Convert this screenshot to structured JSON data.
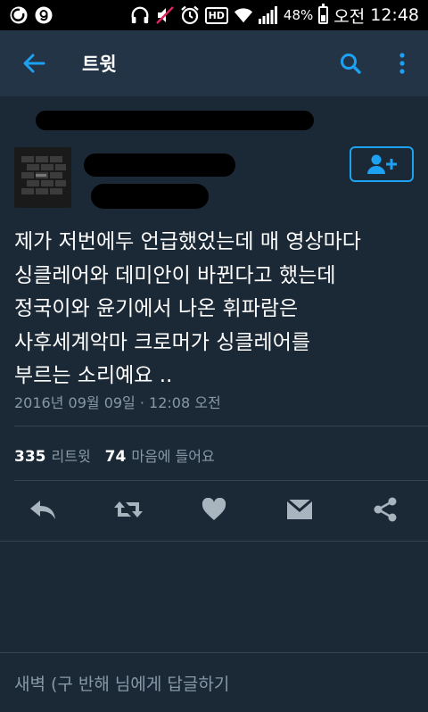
{
  "status_bar": {
    "battery": "48%",
    "battery_level": 0.48,
    "ampm": "오전",
    "time": "12:48",
    "hd_label": "HD",
    "icons": [
      "circle-app-icon",
      "g-app-icon",
      "headset-icon",
      "mute-icon",
      "alarm-icon",
      "hd-icon",
      "wifi-icon",
      "signal-icon",
      "battery-icon"
    ]
  },
  "app_bar": {
    "title": "트윗",
    "back_icon": "back-arrow-icon",
    "search_icon": "search-icon",
    "more_icon": "overflow-menu-icon"
  },
  "tweet": {
    "text": "제가 저번에두 언급했었는데 매 영상마다\n싱클레어와 데미안이 바뀐다고 했는데\n정국이와 윤기에서 나온 휘파람은\n사후세계악마 크로머가 싱클레어를\n부르는 소리예요 ..",
    "timestamp": "2016년 09월 09일 · 12:08 오전",
    "follow_icon": "add-user-icon"
  },
  "stats": {
    "retweets": "335",
    "retweets_label": "리트윗",
    "likes": "74",
    "likes_label": "마음에 들어요"
  },
  "actions": [
    "reply-icon",
    "retweet-icon",
    "like-icon",
    "direct-message-icon",
    "share-icon"
  ],
  "reply_bar": {
    "placeholder": "새벽 (구 반해 님에게 답글하기"
  },
  "colors": {
    "background": "#1b2836",
    "app_bar": "#243447",
    "accent": "#1da1f2",
    "secondary_text": "#8899a6",
    "icon_gray": "#a8b4be"
  }
}
